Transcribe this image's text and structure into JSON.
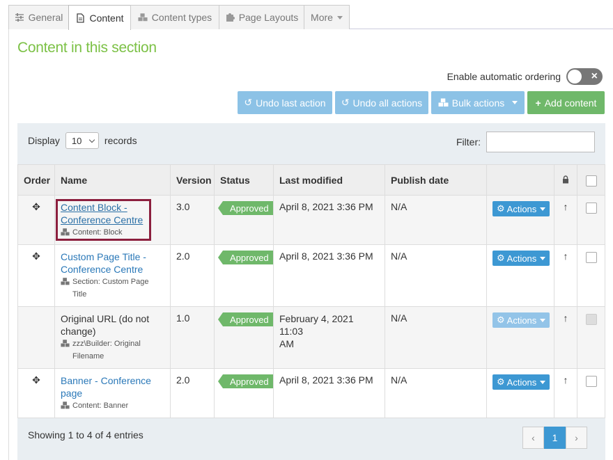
{
  "tabs": [
    {
      "label": "General",
      "icon": "sliders-icon"
    },
    {
      "label": "Content",
      "icon": "document-icon"
    },
    {
      "label": "Content types",
      "icon": "cubes-icon"
    },
    {
      "label": "Page Layouts",
      "icon": "puzzle-icon"
    },
    {
      "label": "More",
      "icon": "chevron-down-icon"
    }
  ],
  "section": {
    "title": "Content in this section"
  },
  "ordering": {
    "label": "Enable automatic ordering",
    "enabled": false
  },
  "toolbar": {
    "undo_last": "Undo last action",
    "undo_all": "Undo all actions",
    "bulk": "Bulk actions",
    "add": "Add content"
  },
  "display": {
    "prefix": "Display",
    "value": "10",
    "suffix": "records"
  },
  "filter": {
    "label": "Filter:",
    "value": ""
  },
  "table": {
    "headers": {
      "order": "Order",
      "name": "Name",
      "version": "Version",
      "status": "Status",
      "last_modified": "Last modified",
      "publish_date": "Publish date"
    },
    "rows": [
      {
        "name_line1": "Content Block -",
        "name_line2": "Conference Centre",
        "type": "Content: Block",
        "version": "3.0",
        "status": "Approved",
        "modified_line1": "April 8, 2021 3:36 PM",
        "modified_line2": "",
        "publish": "N/A",
        "actions": "Actions"
      },
      {
        "name_line1": "Custom Page Title -",
        "name_line2": "Conference Centre",
        "type_line1": "Section: Custom Page",
        "type_line2": "Title",
        "version": "2.0",
        "status": "Approved",
        "modified_line1": "April 8, 2021 3:36 PM",
        "modified_line2": "",
        "publish": "N/A",
        "actions": "Actions"
      },
      {
        "name_line1": "Original URL (do not",
        "name_line2": "change)",
        "type_line1": "zzz\\Builder: Original",
        "type_line2": "Filename",
        "version": "1.0",
        "status": "Approved",
        "modified_line1": "February 4, 2021 11:03",
        "modified_line2": "AM",
        "publish": "N/A",
        "actions": "Actions"
      },
      {
        "name_line1": "Banner - Conference",
        "name_line2": "page",
        "type": "Content: Banner",
        "version": "2.0",
        "status": "Approved",
        "modified_line1": "April 8, 2021 3:36 PM",
        "modified_line2": "",
        "publish": "N/A",
        "actions": "Actions"
      }
    ]
  },
  "footer": {
    "showing": "Showing 1 to 4 of 4 entries",
    "prev": "‹",
    "page": "1",
    "next": "›"
  },
  "colors": {
    "accent_green": "#7cc146",
    "button_blue": "#3d98d3",
    "approved_green": "#6fb86a",
    "highlight": "#8c1f3e"
  }
}
